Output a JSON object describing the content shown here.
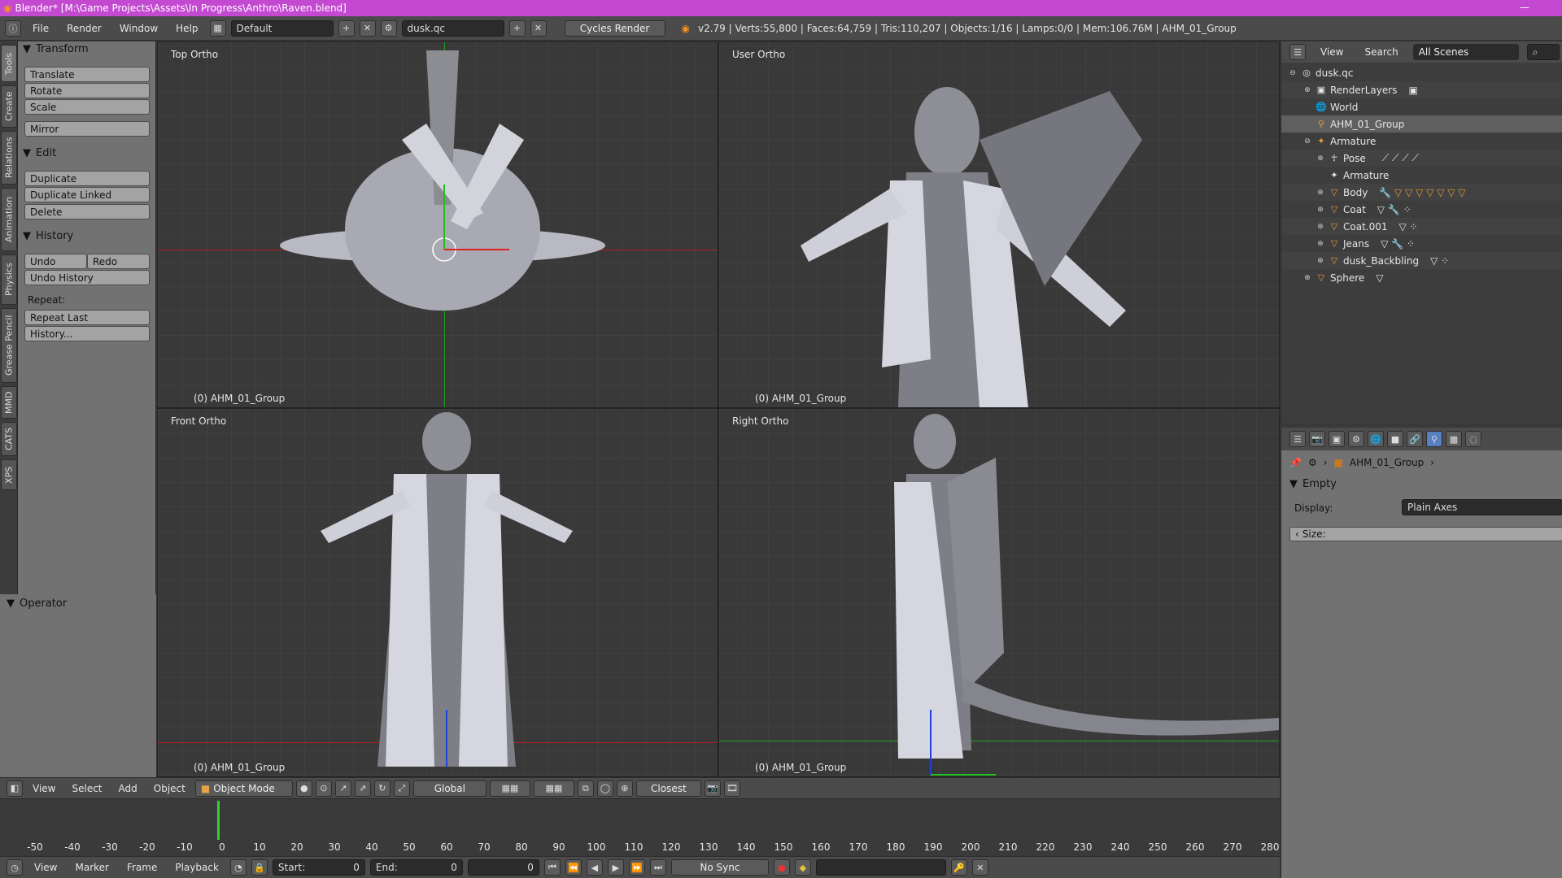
{
  "titlebar": {
    "title": "Blender* [M:\\Game Projects\\Assets\\In Progress\\Anthro\\Raven.blend]"
  },
  "infobar": {
    "menus": [
      "File",
      "Render",
      "Window",
      "Help"
    ],
    "layout": "Default",
    "scene": "dusk.qc",
    "engine": "Cycles Render",
    "stats": "v2.79 | Verts:55,800 | Faces:64,759 | Tris:110,207 | Objects:1/16 | Lamps:0/0 | Mem:106.76M | AHM_01_Group"
  },
  "tabs": [
    "Tools",
    "Create",
    "Relations",
    "Animation",
    "Physics",
    "Grease Pencil",
    "MMD",
    "CATS",
    "XPS"
  ],
  "toolshelf": {
    "transform": {
      "title": "Transform",
      "buttons": [
        "Translate",
        "Rotate",
        "Scale",
        "Mirror"
      ]
    },
    "edit": {
      "title": "Edit",
      "buttons": [
        "Duplicate",
        "Duplicate Linked",
        "Delete"
      ]
    },
    "history": {
      "title": "History",
      "undo": "Undo",
      "redo": "Redo",
      "undo_history": "Undo History",
      "repeat_label": "Repeat:",
      "repeat_last": "Repeat Last",
      "history_btn": "History..."
    },
    "operator": {
      "title": "Operator"
    }
  },
  "viewports": [
    {
      "label": "Top Ortho",
      "object": "(0) AHM_01_Group"
    },
    {
      "label": "User Ortho",
      "object": "(0) AHM_01_Group"
    },
    {
      "label": "Front Ortho",
      "object": "(0) AHM_01_Group"
    },
    {
      "label": "Right Ortho",
      "object": "(0) AHM_01_Group"
    }
  ],
  "vheader": {
    "menus": [
      "View",
      "Select",
      "Add",
      "Object"
    ],
    "mode": "Object Mode",
    "orientation": "Global",
    "snap": "Closest"
  },
  "timeline": {
    "ticks": [
      "-50",
      "-40",
      "-30",
      "-20",
      "-10",
      "0",
      "10",
      "20",
      "30",
      "40",
      "50",
      "60",
      "70",
      "80",
      "90",
      "100",
      "110",
      "120",
      "130",
      "140",
      "150",
      "160",
      "170",
      "180",
      "190",
      "200",
      "210",
      "220",
      "230",
      "240",
      "250",
      "260",
      "270",
      "280"
    ],
    "menus": [
      "View",
      "Marker",
      "Frame",
      "Playback"
    ],
    "start_label": "Start:",
    "start_value": "0",
    "end_label": "End:",
    "end_value": "0",
    "current": "0",
    "sync": "No Sync"
  },
  "outliner": {
    "menus": [
      "View",
      "Search"
    ],
    "filter": "All Scenes",
    "rows": [
      "dusk.qc",
      "RenderLayers",
      "World",
      "AHM_01_Group",
      "Armature",
      "Pose",
      "Armature",
      "Body",
      "Coat",
      "Coat.001",
      "Jeans",
      "dusk_Backbling",
      "Sphere"
    ]
  },
  "properties": {
    "breadcrumb": "AHM_01_Group",
    "panel": "Empty",
    "display_label": "Display:",
    "display_value": "Plain Axes",
    "size_label": "Size:"
  },
  "colors": {
    "titlebar": "#c34ad0",
    "x_axis": "#e02020",
    "y_axis": "#20c020",
    "z_axis": "#2040e0",
    "playhead": "#32d030"
  }
}
